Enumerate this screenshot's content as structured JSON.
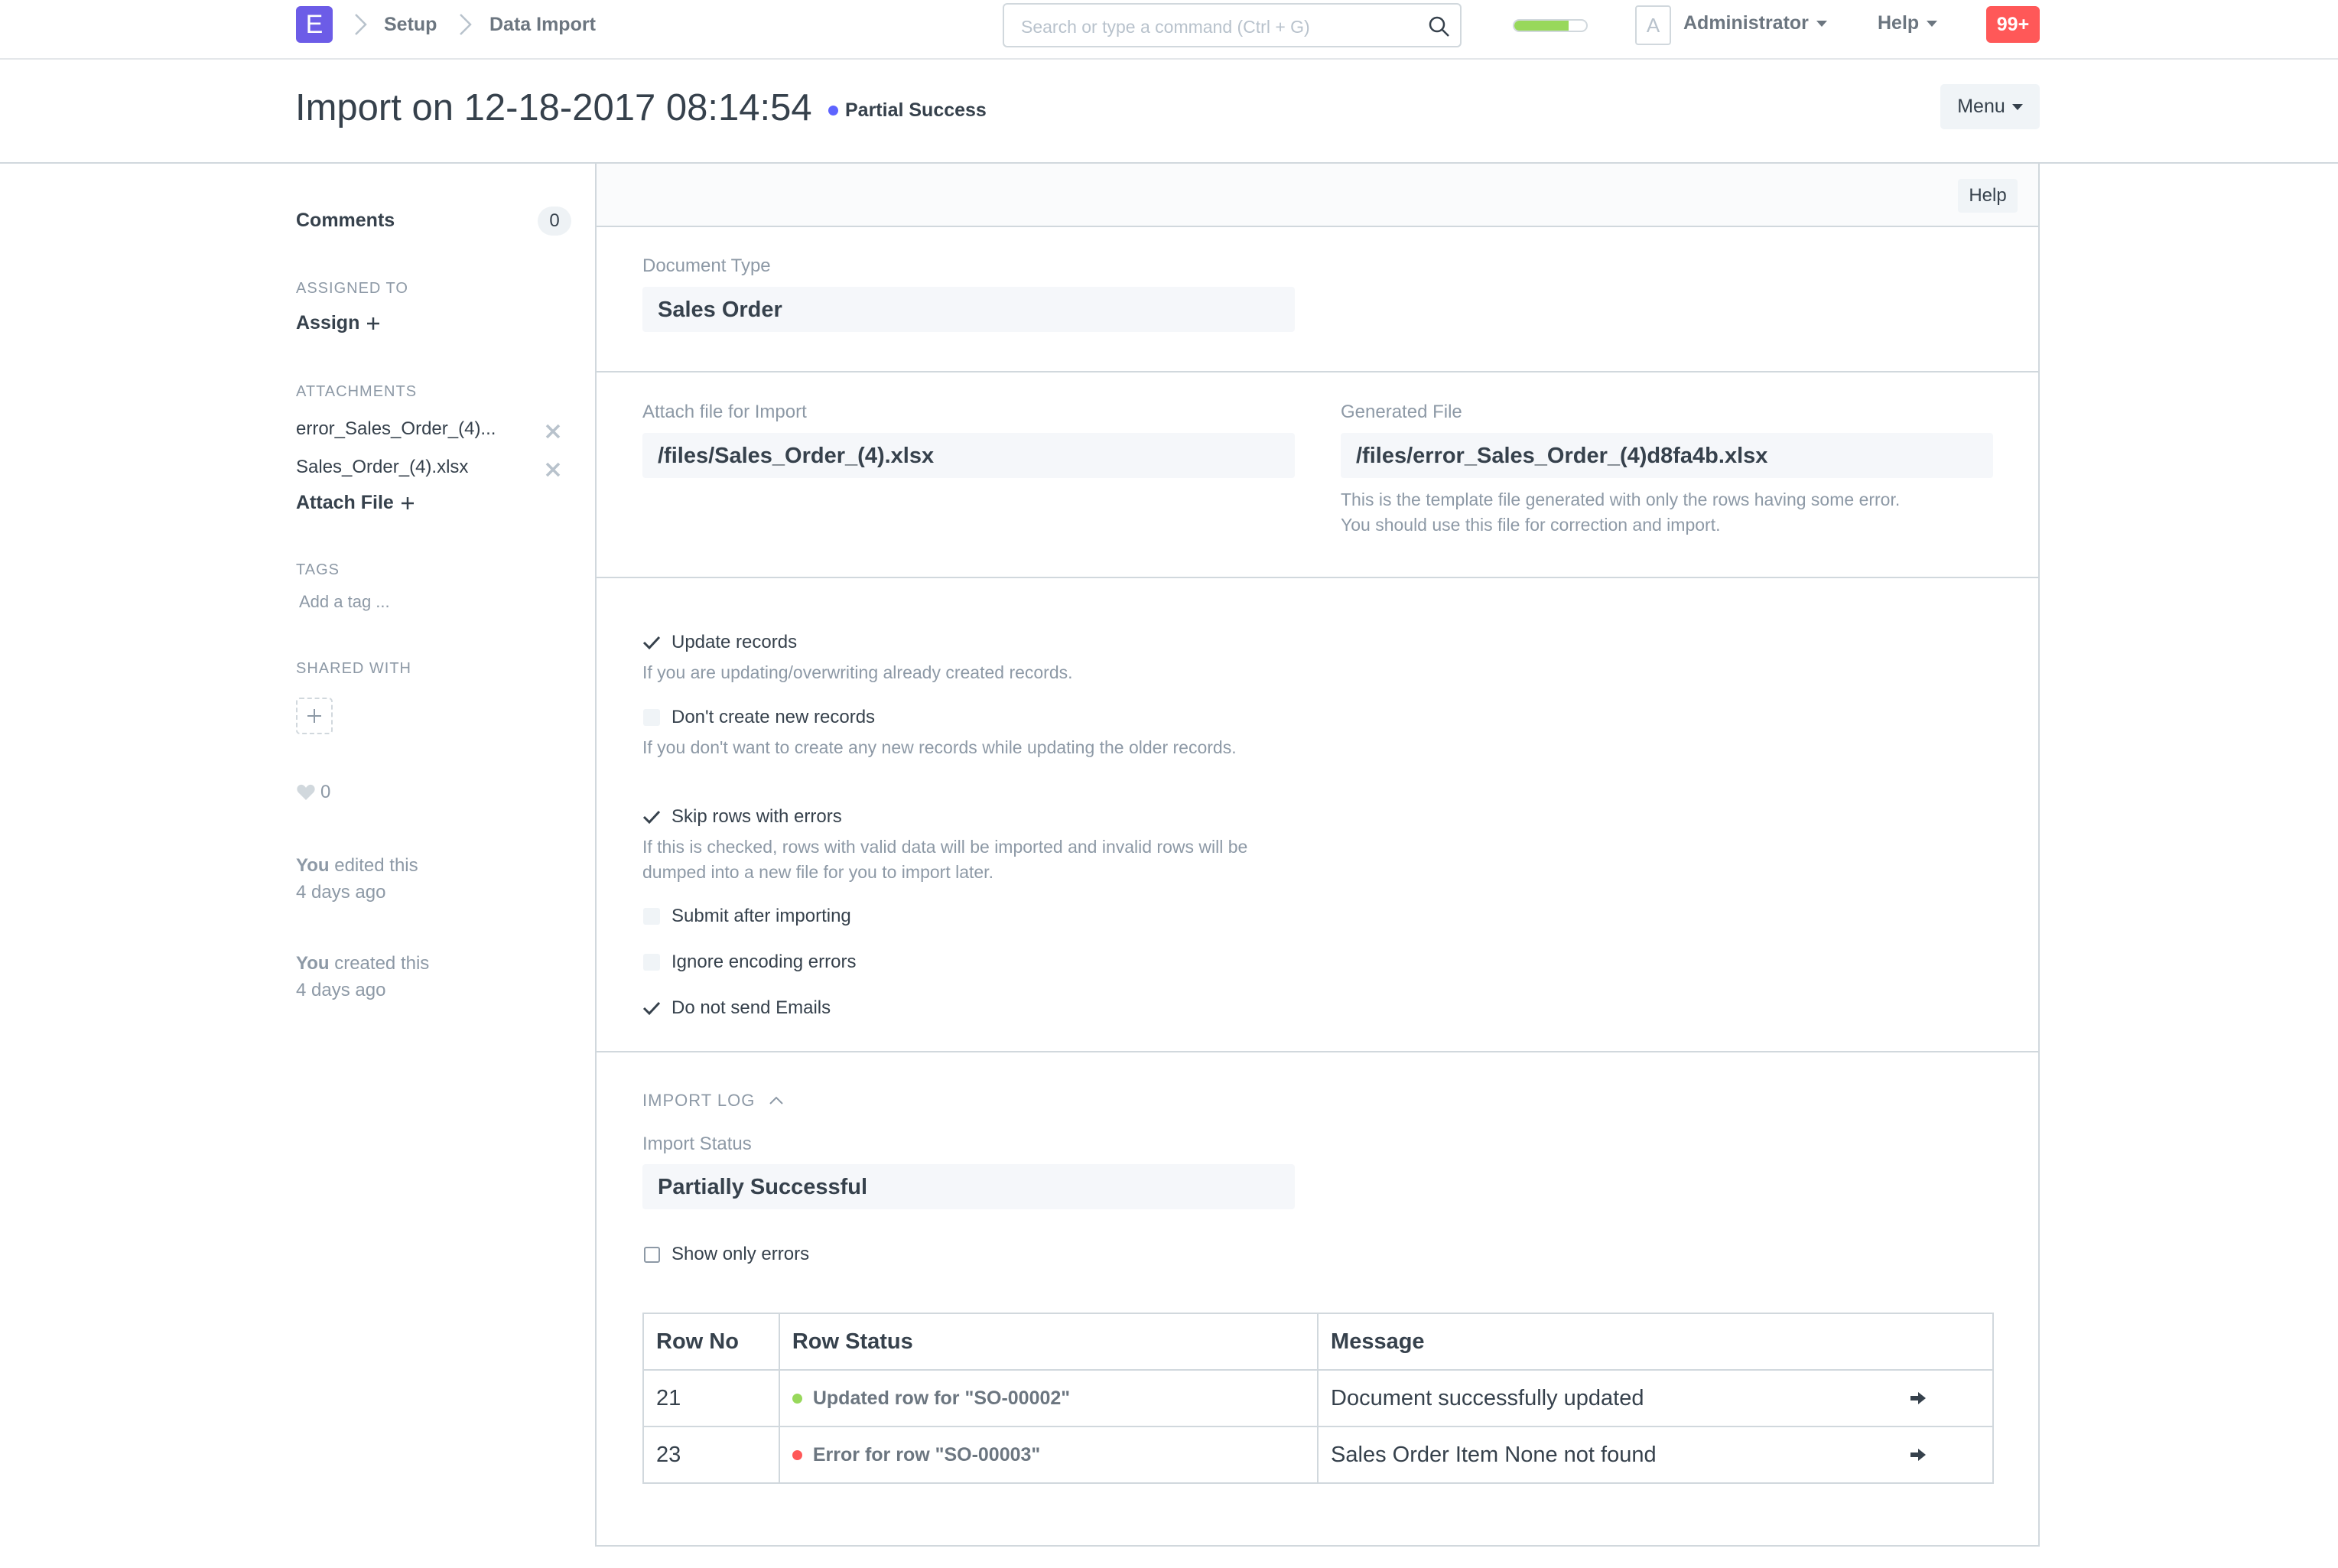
{
  "navbar": {
    "brand_letter": "E",
    "breadcrumbs": [
      "Setup",
      "Data Import"
    ],
    "search_placeholder": "Search or type a command (Ctrl + G)",
    "progress_fraction": 0.75,
    "avatar_letter": "A",
    "user_menu": "Administrator",
    "help_menu": "Help",
    "notifications": "99+"
  },
  "page": {
    "title": "Import on 12-18-2017 08:14:54",
    "status": "Partial Success",
    "status_color": "#5e64ff",
    "menu_label": "Menu"
  },
  "sidebar": {
    "comments_label": "Comments",
    "comments_count": "0",
    "assigned_to_label": "ASSIGNED TO",
    "assign_label": "Assign",
    "attachments_label": "ATTACHMENTS",
    "attachments": [
      "error_Sales_Order_(4)...",
      "Sales_Order_(4).xlsx"
    ],
    "attach_file_label": "Attach File",
    "tags_label": "TAGS",
    "add_tag": "Add a tag ...",
    "shared_with_label": "SHARED WITH",
    "likes": "0",
    "timeline": [
      {
        "who": "You",
        "action": "edited this",
        "when": "4 days ago"
      },
      {
        "who": "You",
        "action": "created this",
        "when": "4 days ago"
      }
    ]
  },
  "form": {
    "help_label": "Help",
    "document_type_label": "Document Type",
    "document_type_value": "Sales Order",
    "attach_file_label": "Attach file for Import",
    "attach_file_value": "/files/Sales_Order_(4).xlsx",
    "generated_file_label": "Generated File",
    "generated_file_value": "/files/error_Sales_Order_(4)d8fa4b.xlsx",
    "generated_file_desc_1": "This is the template file generated with only the rows having some error.",
    "generated_file_desc_2": "You should use this file for correction and import.",
    "options": [
      {
        "label": "Update records",
        "checked": true,
        "desc": "If you are updating/overwriting already created records."
      },
      {
        "label": "Don't create new records",
        "checked": false,
        "desc": "If you don't want to create any new records while updating the older records."
      },
      {
        "label": "Skip rows with errors",
        "checked": true,
        "desc": "If this is checked, rows with valid data will be imported and invalid rows will be dumped into a new file for you to import later."
      },
      {
        "label": "Submit after importing",
        "checked": false,
        "desc": ""
      },
      {
        "label": "Ignore encoding errors",
        "checked": false,
        "desc": ""
      },
      {
        "label": "Do not send Emails",
        "checked": true,
        "desc": ""
      }
    ],
    "import_log_label": "IMPORT LOG",
    "import_status_label": "Import Status",
    "import_status_value": "Partially Successful",
    "show_only_errors_label": "Show only errors",
    "show_only_errors_checked": false,
    "log_table": {
      "headers": [
        "Row No",
        "Row Status",
        "Message"
      ],
      "rows": [
        {
          "row_no": "21",
          "status": "Updated row for \"SO-00002\"",
          "status_color": "#98d85b",
          "message": "Document successfully updated"
        },
        {
          "row_no": "23",
          "status": "Error for row \"SO-00003\"",
          "status_color": "#ff5858",
          "message": "Sales Order Item None not found"
        }
      ]
    }
  }
}
